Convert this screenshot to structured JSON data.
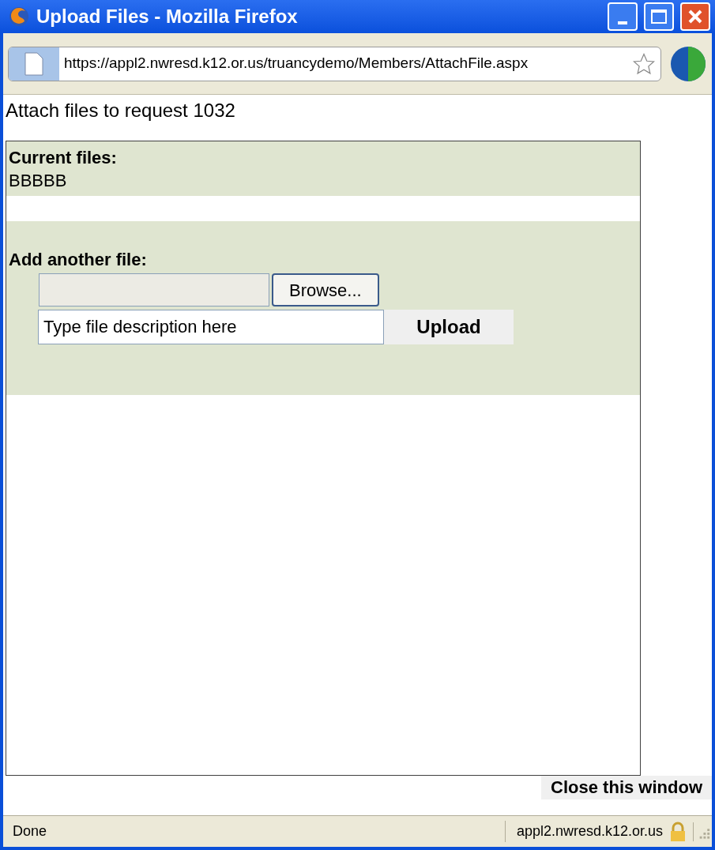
{
  "window": {
    "title": "Upload Files - Mozilla Firefox"
  },
  "address_bar": {
    "url": "https://appl2.nwresd.k12.or.us/truancydemo/Members/AttachFile.aspx"
  },
  "page": {
    "heading": "Attach files to request 1032",
    "current_files": {
      "label": "Current files:",
      "files": [
        "BBBBB"
      ]
    },
    "add_file": {
      "label": "Add another file:",
      "browse_button": "Browse...",
      "description": {
        "value": "Type file description here"
      },
      "upload_button": "Upload"
    },
    "close_button": "Close this window"
  },
  "status_bar": {
    "status": "Done",
    "host": "appl2.nwresd.k12.or.us"
  }
}
